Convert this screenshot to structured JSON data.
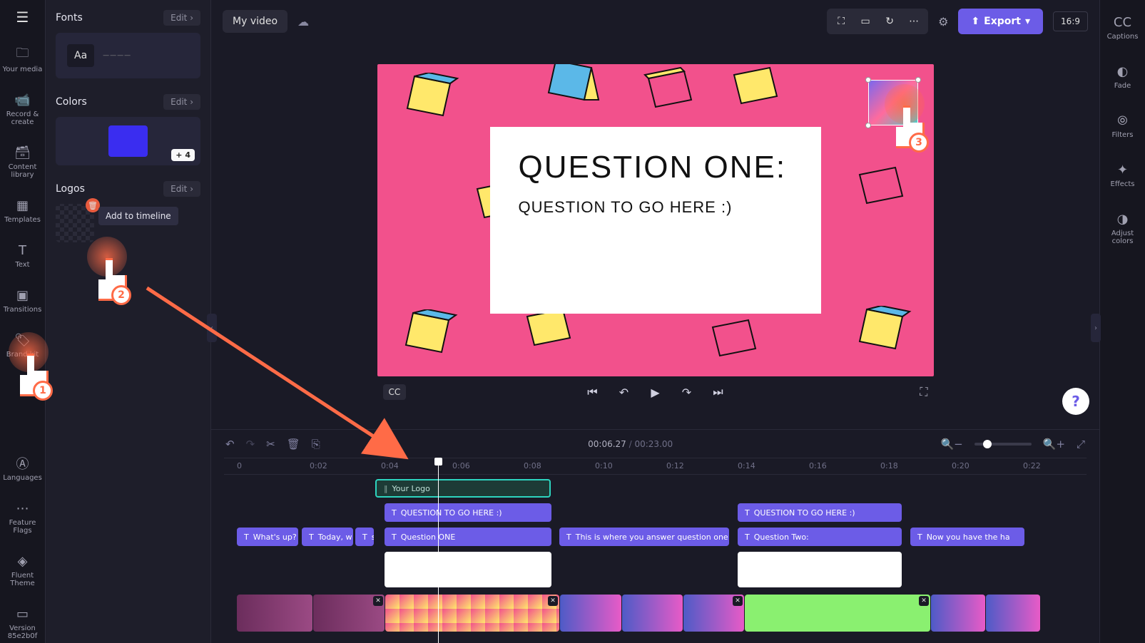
{
  "rail": {
    "yourMedia": "Your media",
    "recordCreate": "Record & create",
    "contentLibrary": "Content library",
    "templates": "Templates",
    "text": "Text",
    "transitions": "Transitions",
    "brandKit": "Brand kit",
    "languages": "Languages",
    "featureFlags": "Feature Flags",
    "fluentTheme": "Fluent Theme",
    "version": "Version 85e2b0f"
  },
  "panel": {
    "fonts": {
      "title": "Fonts",
      "edit": "Edit  ›",
      "sample": "Aa"
    },
    "colors": {
      "title": "Colors",
      "edit": "Edit  ›",
      "more": "+ 4"
    },
    "logos": {
      "title": "Logos",
      "edit": "Edit  ›",
      "tooltip": "Add to timeline"
    }
  },
  "top": {
    "project": "My video",
    "export": "Export",
    "aspect": "16:9"
  },
  "canvas": {
    "q1": "Question One:",
    "q2": "Question to go here :)"
  },
  "player": {
    "cc": "CC"
  },
  "time": {
    "current": "00:06.27",
    "total": "00:23.00"
  },
  "ruler": [
    "0",
    "0:02",
    "0:04",
    "0:06",
    "0:08",
    "0:10",
    "0:12",
    "0:14",
    "0:16",
    "0:18",
    "0:20",
    "0:22"
  ],
  "clips": {
    "logo": "Your Logo",
    "qhere1": "QUESTION TO GO HERE :)",
    "qhere2": "QUESTION TO GO HERE :)",
    "whatsup": "What's up?",
    "today": "Today, w",
    "s": "s",
    "qone": "Question ONE",
    "answer": "This is where you answer question one",
    "qtwo": "Question Two:",
    "nowhave": "Now you have the ha"
  },
  "rightRail": {
    "captions": "Captions",
    "fade": "Fade",
    "filters": "Filters",
    "effects": "Effects",
    "adjustColors": "Adjust colors"
  },
  "callouts": {
    "n1": "1",
    "n2": "2",
    "n3": "3"
  },
  "help": "?"
}
